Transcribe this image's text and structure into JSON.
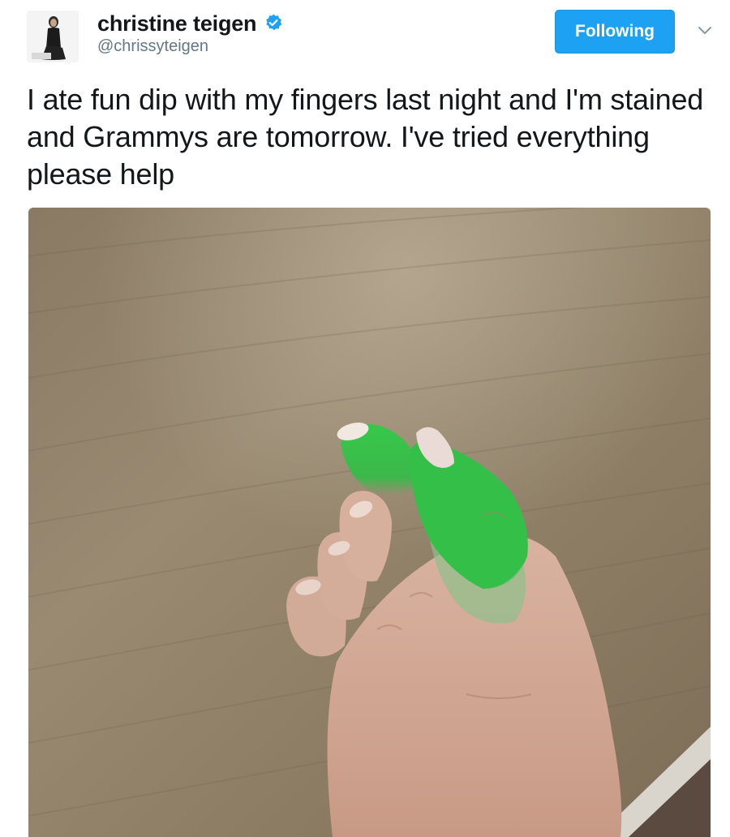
{
  "user": {
    "display_name": "christine teigen",
    "handle": "@chrissyteigen",
    "verified_icon": "verified-badge-icon",
    "avatar_icon": "avatar-photo"
  },
  "actions": {
    "follow_label": "Following",
    "menu_icon": "chevron-down-icon"
  },
  "tweet": {
    "text": "I ate fun dip with my fingers last night and I'm stained and Grammys are tomorrow. I've tried everything please help"
  },
  "media": {
    "type": "photo"
  },
  "colors": {
    "accent": "#1da1f2",
    "handle": "#657786",
    "text": "#14171a",
    "stain_green": "#3bc24a"
  }
}
